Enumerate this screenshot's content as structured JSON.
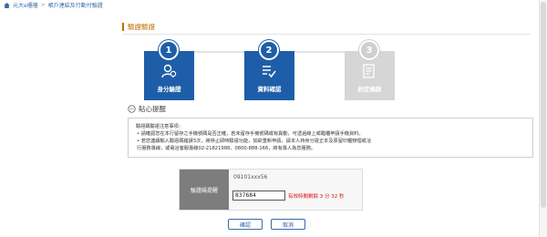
{
  "breadcrumb": {
    "items": [
      "元大e櫃檯",
      "帳戶連結及行動付驗證"
    ]
  },
  "section": {
    "title": "驗證驗證"
  },
  "steps": [
    {
      "num": "1",
      "label": "身分驗證",
      "state": "active",
      "icon": "identity-icon"
    },
    {
      "num": "2",
      "label": "資料確認",
      "state": "done",
      "icon": "checklist-icon"
    },
    {
      "num": "3",
      "label": "約定條款",
      "state": "pending",
      "icon": "contract-icon"
    }
  ],
  "notice": {
    "title": "貼心提醒",
    "heading": "驗證碼驗證注意事項：",
    "items": [
      "• 請確認您在本行留存之手機號碼是否正確，若未留存手機號碼或有異動，可透過線上或臨櫃申請手機資料。",
      "• 若您連續輸入驗證碼錯誤3次，將停止即時驗證功能，如欲重新申請，請本人持身分證正本及原留印鑑辦理或洽",
      "  行服務專線，或電洽客服專線02-21821988、0800-888-166，將有專人為您服務。"
    ]
  },
  "verify": {
    "label": "驗證碼提醒",
    "phone": "09101xxx56",
    "code_value": "837684",
    "timer": "有效時間剩餘 3 分 32 秒"
  },
  "buttons": {
    "confirm": "確認",
    "cancel": "取消"
  },
  "colors": {
    "primary": "#1e5ea8",
    "accent": "#c16d00",
    "pending": "#d6d6d6",
    "alert": "#dd1111"
  }
}
